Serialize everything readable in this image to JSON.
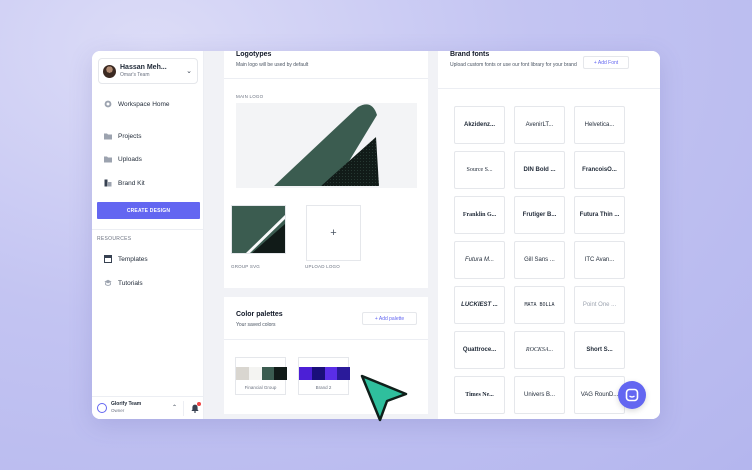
{
  "sidebar": {
    "user": {
      "name": "Hassan Meh...",
      "team": "Omar's Team"
    },
    "nav": [
      {
        "label": "Workspace Home",
        "icon": "home-icon"
      },
      {
        "label": "Projects",
        "icon": "folder-icon"
      },
      {
        "label": "Uploads",
        "icon": "folder-icon"
      },
      {
        "label": "Brand Kit",
        "icon": "brand-kit-icon"
      }
    ],
    "create_label": "CREATE DESIGN",
    "resources_label": "RESOURCES",
    "resources": [
      {
        "label": "Templates",
        "icon": "templates-icon"
      },
      {
        "label": "Tutorials",
        "icon": "tutorials-icon"
      }
    ],
    "footer": {
      "team": "Glorify Team",
      "role": "Owner"
    }
  },
  "logotypes": {
    "title": "Logotypes",
    "subtitle": "Main logo will be used by default",
    "main_label": "MAIN LOGO",
    "thumbs": [
      {
        "label": "GROUP SVG"
      },
      {
        "label": "UPLOAD LOGO",
        "glyph": "+"
      }
    ]
  },
  "palettes": {
    "title": "Color palettes",
    "subtitle": "Your saved colors",
    "add_label": "+ Add palette",
    "items": [
      {
        "name": "Financial Group",
        "colors": [
          "#d9d6d0",
          "#f4f4f2",
          "#3b5c50",
          "#111b18"
        ]
      },
      {
        "name": "Brand 2",
        "colors": [
          "#4c1fd6",
          "#1a0f7a",
          "#5a2ee8",
          "#2a1a9a"
        ]
      }
    ]
  },
  "fonts": {
    "title": "Brand fonts",
    "subtitle": "Upload custom fonts or use our font library for your brand",
    "add_label": "+ Add Font",
    "items": [
      "Akzidenz...",
      "AvenirLT...",
      "Helvetica...",
      "Source S...",
      "DIN Bold ...",
      "FrancoisO...",
      "Franklin G...",
      "Frutiger B...",
      "Futura Thin ...",
      "Futura M...",
      "Gill Sans ...",
      "ITC Avan...",
      "LUCKIEST ...",
      "MATA BOLLA",
      "Point One ...",
      "Quattroce...",
      "ROCKSA...",
      "Short S...",
      "Times Ne...",
      "Univers B...",
      "VAG RounD..."
    ]
  },
  "colors": {
    "accent": "#6366f1",
    "logo_green": "#3b5c50",
    "logo_dark": "#111b18",
    "cursor": "#2fbf9d"
  }
}
